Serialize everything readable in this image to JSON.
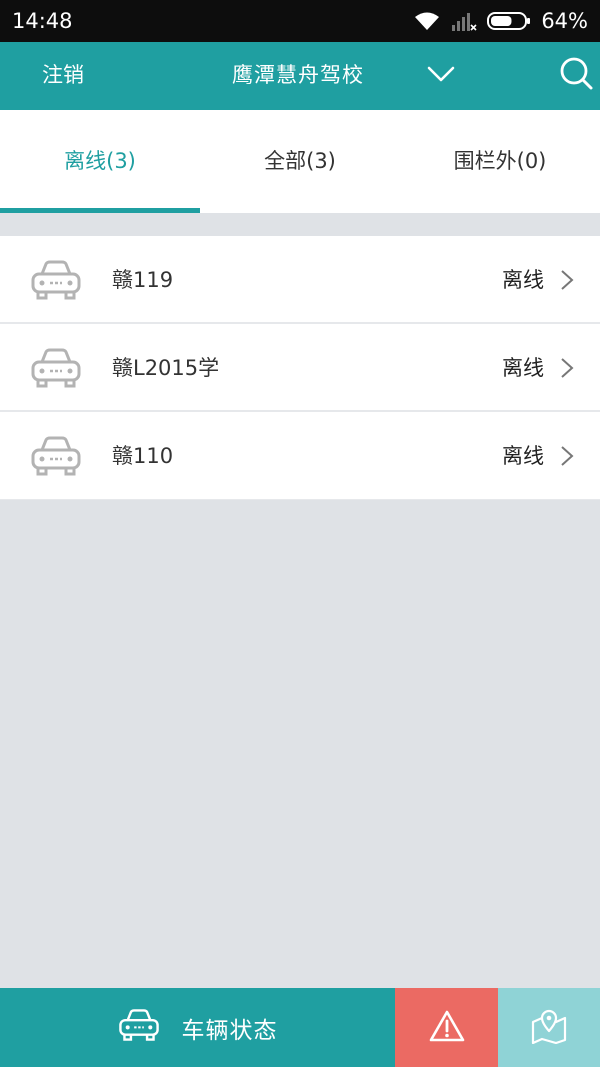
{
  "status_bar": {
    "time": "14:48",
    "battery": "64%",
    "battery_level": 0.64
  },
  "header": {
    "logout_label": "注销",
    "title": "鹰潭慧舟驾校",
    "dropdown_icon": "chevron-down-icon",
    "search_icon": "search-icon"
  },
  "tabs": [
    {
      "label": "离线(3)",
      "active": true
    },
    {
      "label": "全部(3)",
      "active": false
    },
    {
      "label": "围栏外(0)",
      "active": false
    }
  ],
  "vehicles": [
    {
      "plate": "赣119",
      "status": "离线",
      "icon": "car-icon"
    },
    {
      "plate": "赣L2015学",
      "status": "离线",
      "icon": "car-icon"
    },
    {
      "plate": "赣110",
      "status": "离线",
      "icon": "car-icon"
    }
  ],
  "bottom_bar": {
    "vehicle_status_label": "车辆状态",
    "alert_icon": "warning-icon",
    "map_icon": "map-pin-icon"
  },
  "colors": {
    "primary": "#1f9fa1",
    "alert": "#eb6a63",
    "map": "#8fd3d6",
    "background": "#dfe2e6"
  }
}
